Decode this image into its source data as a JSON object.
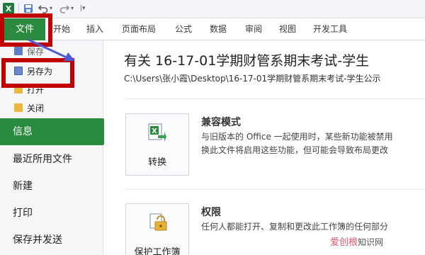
{
  "colors": {
    "accent": "#2a8b3f",
    "highlight": "#c00000",
    "arrow": "#4f5bd5"
  },
  "app_logo": "X",
  "ribbon": {
    "file_tab": "文件",
    "tabs": [
      "开始",
      "插入",
      "页面布局",
      "公式",
      "数据",
      "审阅",
      "视图",
      "开发工具"
    ]
  },
  "backstage": {
    "save": "保存",
    "save_as": "另存为",
    "open": "打开",
    "close": "关闭",
    "info": "信息",
    "recent": "最近所用文件",
    "new": "新建",
    "print": "打印",
    "save_send": "保存并发送"
  },
  "main": {
    "title": "有关 16-17-01学期财管系期末考试-学生",
    "path": "C:\\Users\\张小霞\\Desktop\\16-17-01学期财管系期末考试-学生公示",
    "compat": {
      "button": "转换",
      "heading": "兼容模式",
      "line1": "与旧版本的 Office 一起使用时，某些新功能被禁用",
      "line2": "换此文件将启用这些功能，但可能会导致布局更改"
    },
    "perm": {
      "button": "保护工作簿",
      "heading": "权限",
      "line1": "任何人都能打开、复制和更改此工作簿的任何部分"
    }
  },
  "watermark": {
    "main": "爱创根",
    "sub": "知识网"
  }
}
